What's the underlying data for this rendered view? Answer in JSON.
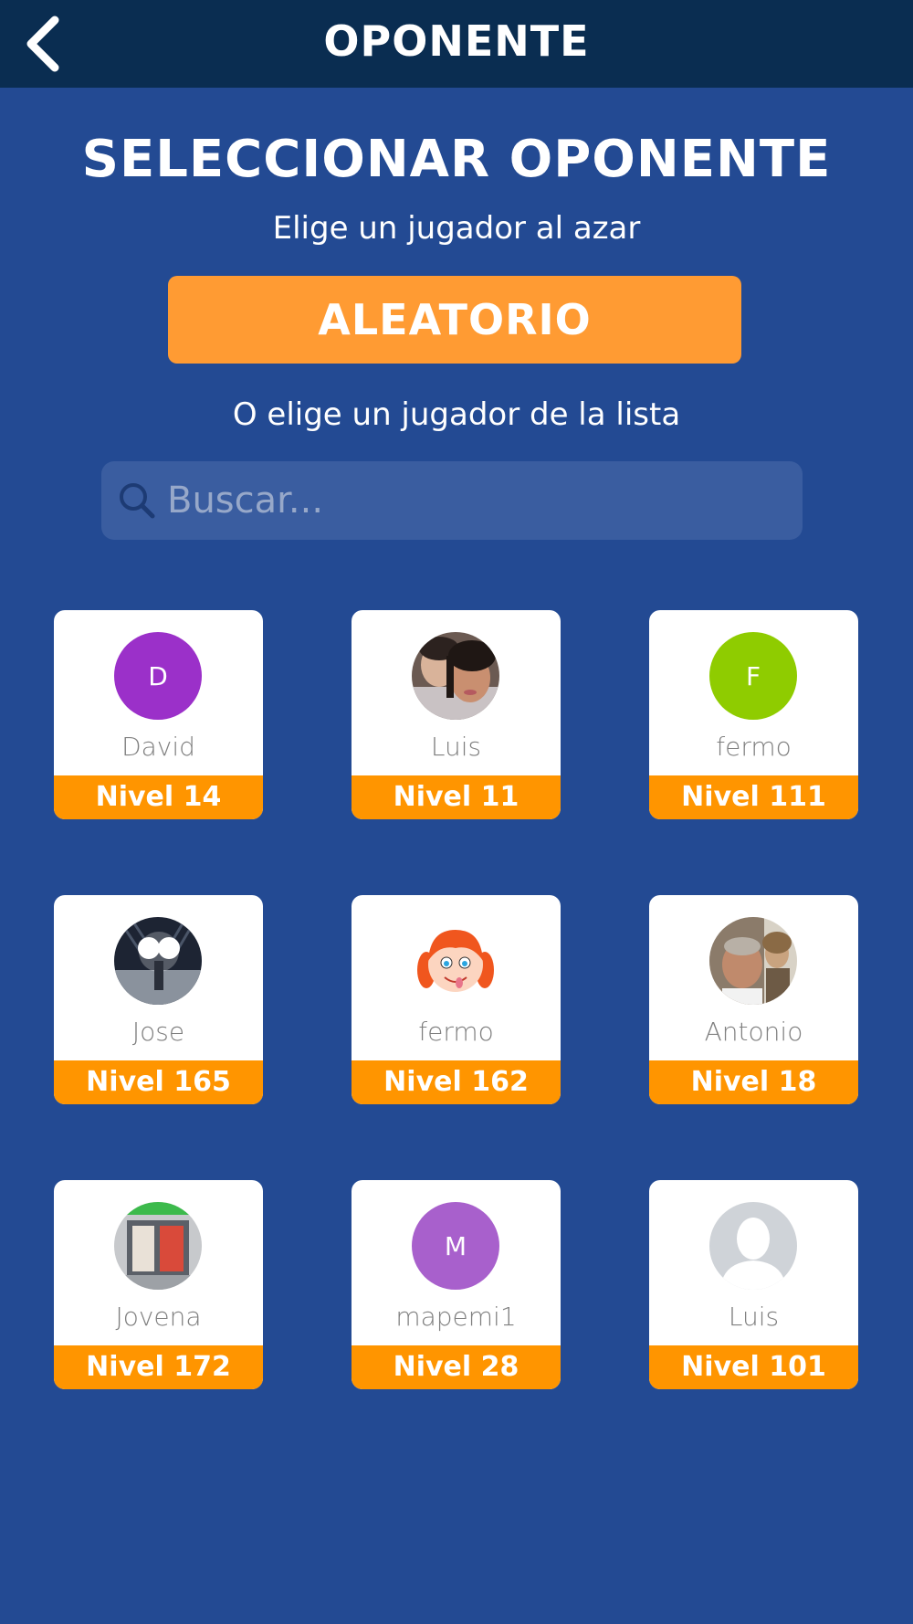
{
  "header": {
    "title": "OPONENTE",
    "back_icon": "chevron-left-icon"
  },
  "main": {
    "heading": "SELECCIONAR OPONENTE",
    "random_subtitle": "Elige un jugador al azar",
    "random_button_label": "ALEATORIO",
    "list_subtitle": "O elige un jugador de la lista",
    "search": {
      "placeholder": "Buscar...",
      "value": "",
      "icon": "search-icon"
    }
  },
  "colors": {
    "background": "#234a93",
    "header": "#0a2d51",
    "accent": "#ff9500",
    "random_button": "#ff9b33"
  },
  "players": [
    {
      "name": "David",
      "level": "Nivel 14",
      "avatar": "initial",
      "initial": "D",
      "avatar_color": "#9b30c9"
    },
    {
      "name": "Luis",
      "level": "Nivel 11",
      "avatar": "photo-couple"
    },
    {
      "name": "fermo",
      "level": "Nivel 111",
      "avatar": "initial",
      "initial": "F",
      "avatar_color": "#8fcc00"
    },
    {
      "name": "Jose",
      "level": "Nivel 165",
      "avatar": "photo-night-lights"
    },
    {
      "name": "fermo",
      "level": "Nivel 162",
      "avatar": "cartoon-girl"
    },
    {
      "name": "Antonio",
      "level": "Nivel 18",
      "avatar": "photo-two-people"
    },
    {
      "name": "Jovena",
      "level": "Nivel 172",
      "avatar": "photo-storefront"
    },
    {
      "name": "mapemi1",
      "level": "Nivel 28",
      "avatar": "initial",
      "initial": "M",
      "avatar_color": "#a860cc"
    },
    {
      "name": "Luis",
      "level": "Nivel 101",
      "avatar": "default-silhouette"
    }
  ]
}
